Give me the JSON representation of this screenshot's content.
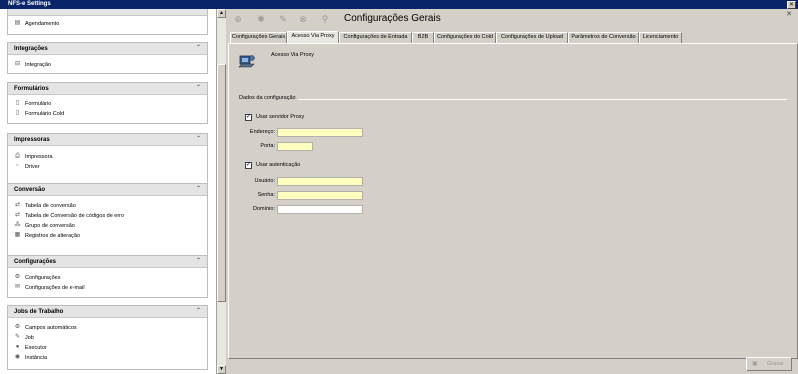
{
  "window": {
    "title": "NFS-e Settings",
    "close_glyph": "✕"
  },
  "sidebar": {
    "top_item": {
      "label": "Agendamento",
      "icon": "calendar-icon"
    },
    "sections": [
      {
        "title": "Integrações",
        "items": [
          {
            "label": "Integração",
            "icon": "integration-icon"
          }
        ]
      },
      {
        "title": "Formulários",
        "items": [
          {
            "label": "Formulário",
            "icon": "form-icon"
          },
          {
            "label": "Formulário Cold",
            "icon": "form-icon"
          }
        ]
      },
      {
        "title": "Impressoras",
        "items": [
          {
            "label": "Impressora",
            "icon": "printer-icon"
          },
          {
            "label": "Driver",
            "icon": "driver-icon"
          }
        ]
      },
      {
        "title": "Conversão",
        "items": [
          {
            "label": "Tabela de conversão",
            "icon": "conversion-icon"
          },
          {
            "label": "Tabela de Conversão de códigos de erro",
            "icon": "conversion-icon"
          },
          {
            "label": "Grupo de conversão",
            "icon": "group-icon"
          },
          {
            "label": "Registros de alteração",
            "icon": "log-icon"
          }
        ]
      },
      {
        "title": "Configurações",
        "items": [
          {
            "label": "Configurações",
            "icon": "gear-icon"
          },
          {
            "label": "Configurações de e-mail",
            "icon": "email-icon"
          }
        ]
      },
      {
        "title": "Jobs de Trabalho",
        "items": [
          {
            "label": "Campos automáticos",
            "icon": "fields-icon"
          },
          {
            "label": "Job",
            "icon": "job-icon"
          },
          {
            "label": "Executor",
            "icon": "executor-icon"
          },
          {
            "label": "Instância",
            "icon": "instance-icon"
          }
        ]
      }
    ]
  },
  "toolbar": {
    "page_title": "Configurações Gerais",
    "buttons": [
      "add-icon",
      "gear-icon",
      "edit-icon",
      "delete-icon",
      "search-icon"
    ]
  },
  "tabs": [
    {
      "label": "Configurações Gerais",
      "active": false
    },
    {
      "label": "Acesso Via Proxy",
      "active": true
    },
    {
      "label": "Configurações de Entrada",
      "active": false
    },
    {
      "label": "B2B",
      "active": false
    },
    {
      "label": "Configurações do Cold",
      "active": false
    },
    {
      "label": "Configurações de Upload",
      "active": false
    },
    {
      "label": "Parâmetros de Conversão",
      "active": false
    },
    {
      "label": "Licenciamento",
      "active": false
    }
  ],
  "content": {
    "header_label": "Acesso Via Proxy",
    "group_label": "Dados da configuração",
    "use_proxy": {
      "label": "Usar servidor Proxy",
      "checked": true
    },
    "address": {
      "label": "Endereço:",
      "value": ""
    },
    "port": {
      "label": "Porta:",
      "value": ""
    },
    "use_auth": {
      "label": "Usar autenticação",
      "checked": true
    },
    "user": {
      "label": "Usuário:",
      "value": ""
    },
    "password": {
      "label": "Senha:",
      "value": ""
    },
    "domain": {
      "label": "Domínio:",
      "value": ""
    },
    "save_label": "Gravar"
  },
  "colors": {
    "titlebar": "#0a246a",
    "field_bg": "#ffffc0",
    "face": "#d4d0c8"
  }
}
